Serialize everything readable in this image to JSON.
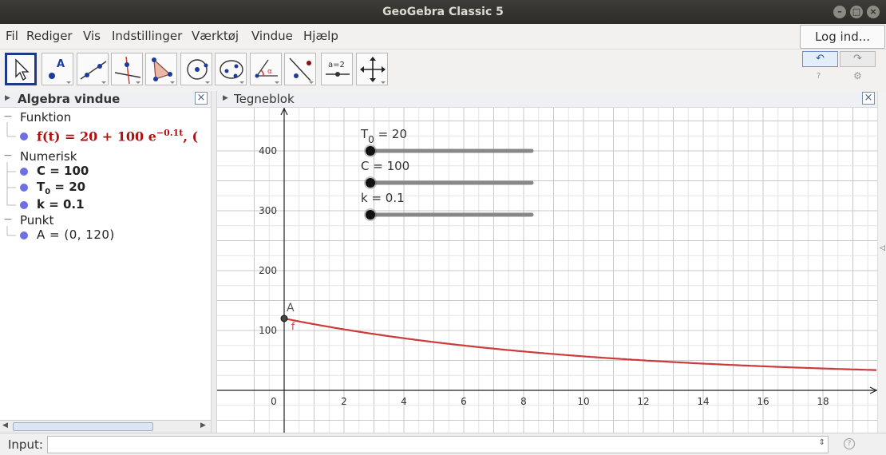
{
  "window": {
    "title": "GeoGebra Classic 5"
  },
  "menu": {
    "items": [
      "Fil",
      "Rediger",
      "Vis",
      "Indstillinger",
      "Værktøj",
      "Vindue",
      "Hjælp"
    ],
    "login": "Log ind..."
  },
  "toolbar": {
    "tools": [
      "move-tool",
      "point-tool",
      "line-tool",
      "perpendicular-line-tool",
      "polygon-tool",
      "circle-tool",
      "conic-tool",
      "angle-tool",
      "reflect-tool",
      "slider-tool",
      "move-graphics-view-tool"
    ],
    "slider_icon_text": "a=2",
    "undo": "↶",
    "redo": "↷",
    "help": "?",
    "settings": "⚙"
  },
  "algebra": {
    "title": "Algebra vindue",
    "groups": [
      {
        "name": "Funktion"
      },
      {
        "name": "Numerisk"
      },
      {
        "name": "Punkt"
      }
    ],
    "function_def": "f(t)  =  20 + 100 e",
    "function_exp": "−0.1t",
    "function_tail": ",    (",
    "numerics": [
      {
        "label": "C = 100"
      },
      {
        "label_main": "T",
        "label_sub": "0",
        "label_rest": " = 20"
      },
      {
        "label": "k = 0.1"
      }
    ],
    "point": "A = (0, 120)"
  },
  "graphics": {
    "title": "Tegneblok",
    "sliders": [
      {
        "name": "T",
        "sub": "0",
        "text": " = 20",
        "value": 20
      },
      {
        "name": "C",
        "sub": "",
        "text": " = 100",
        "value": 100
      },
      {
        "name": "k",
        "sub": "",
        "text": " = 0.1",
        "value": 0.1
      }
    ],
    "x_ticks": [
      0,
      2,
      4,
      6,
      8,
      10,
      12,
      14,
      16,
      18
    ],
    "y_ticks": [
      100,
      200,
      300,
      400
    ],
    "point_label": "A",
    "function_label": "f",
    "curve_color": "#cc3a3a",
    "T0": 20,
    "C": 100,
    "k": 0.1
  },
  "input": {
    "label": "Input:",
    "placeholder": ""
  }
}
